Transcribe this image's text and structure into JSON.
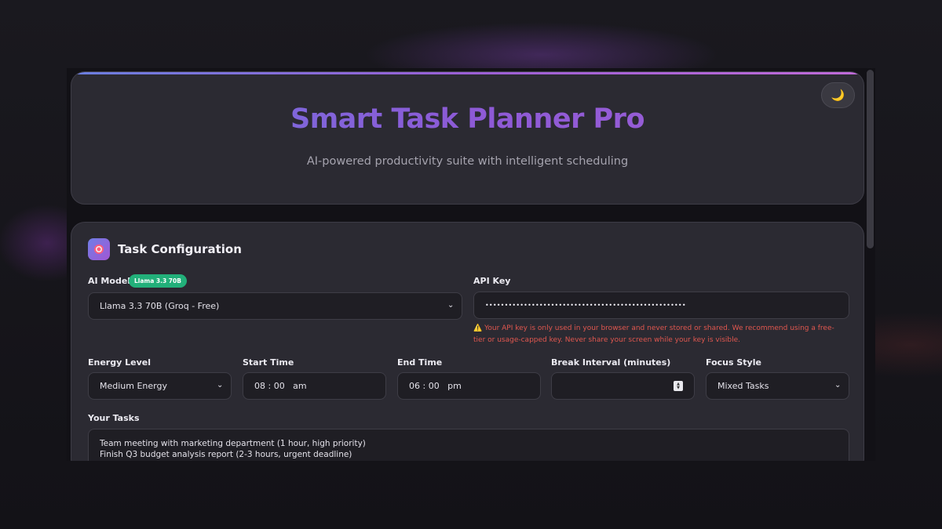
{
  "header": {
    "title": "Smart Task Planner Pro",
    "subtitle": "AI-powered productivity suite with intelligent scheduling",
    "theme_toggle_icon": "moon-icon"
  },
  "config": {
    "section_title": "Task Configuration",
    "section_icon": "target-icon",
    "ai_model": {
      "label": "AI Model",
      "badge": "Llama 3.3 70B",
      "value": "Llama 3.3 70B (Groq - Free)"
    },
    "api_key": {
      "label": "API Key",
      "value": "••••••••••••••••••••••••••••••••••••••••••••••••••••",
      "warning": "⚠️ Your API key is only used in your browser and never stored or shared. We recommend using a free-tier or usage-capped key. Never share your screen while your key is visible."
    },
    "energy_level": {
      "label": "Energy Level",
      "value": "Medium Energy"
    },
    "start_time": {
      "label": "Start Time",
      "value": "08 : 00   am"
    },
    "end_time": {
      "label": "End Time",
      "value": "06 : 00   pm"
    },
    "break_interval": {
      "label": "Break Interval (minutes)",
      "value": ""
    },
    "focus_style": {
      "label": "Focus Style",
      "value": "Mixed Tasks"
    },
    "tasks": {
      "label": "Your Tasks",
      "lines": [
        "Team meeting with marketing department (1 hour, high priority)",
        "Finish Q3 budget analysis report (2-3 hours, urgent deadline)"
      ]
    }
  },
  "colors": {
    "accent_start": "#6f74e0",
    "accent_end": "#a05ed6",
    "badge": "#22b07a",
    "warning": "#e0574f"
  }
}
